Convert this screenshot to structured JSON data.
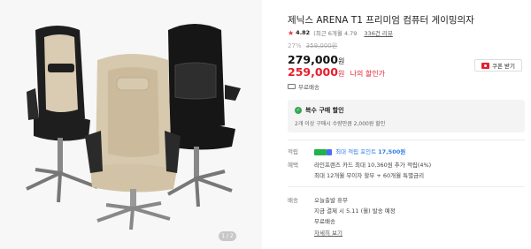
{
  "product": {
    "title": "제닉스 ARENA T1 프리미엄 컴퓨터 게이밍의자",
    "rating_score": "4.82",
    "rating_detail": "(최근 6개월 4.79",
    "review_link": "336건 리뷰",
    "discount_rate": "27%",
    "original_price": "359,000원",
    "price": "279,000",
    "price_unit": "원",
    "sale_price": "259,000",
    "sale_unit": "원",
    "my_discount": "나의 할인가",
    "coupon_label": "쿠폰 받기",
    "shipping": "무료배송"
  },
  "promo": {
    "title": "복수 구매 할인",
    "description": "2개 이상 구매시 수량만큼 2,000원 할인"
  },
  "benefits": {
    "points_label": "적립",
    "points_text": "최대 적립 포인트",
    "points_value": "17,500원",
    "card_label": "혜택",
    "card_line1": "라인프렌즈 카드 최대 10,360원 추가 적립(4%)",
    "card_line2": "최대 12개월 무이자 할부 + 60개월 특별금리"
  },
  "delivery": {
    "label": "배송",
    "line1": "오늘출발 휴무",
    "line2": "지금 결제 시 5.11 (월) 발송 예정",
    "line3": "무료배송",
    "detail_link": "자세히 보기"
  },
  "gallery": {
    "indicator": "1 / 2"
  },
  "colors": {
    "accent_red": "#e61e2d",
    "points_blue": "#2e7be6",
    "success_green": "#33a853"
  }
}
